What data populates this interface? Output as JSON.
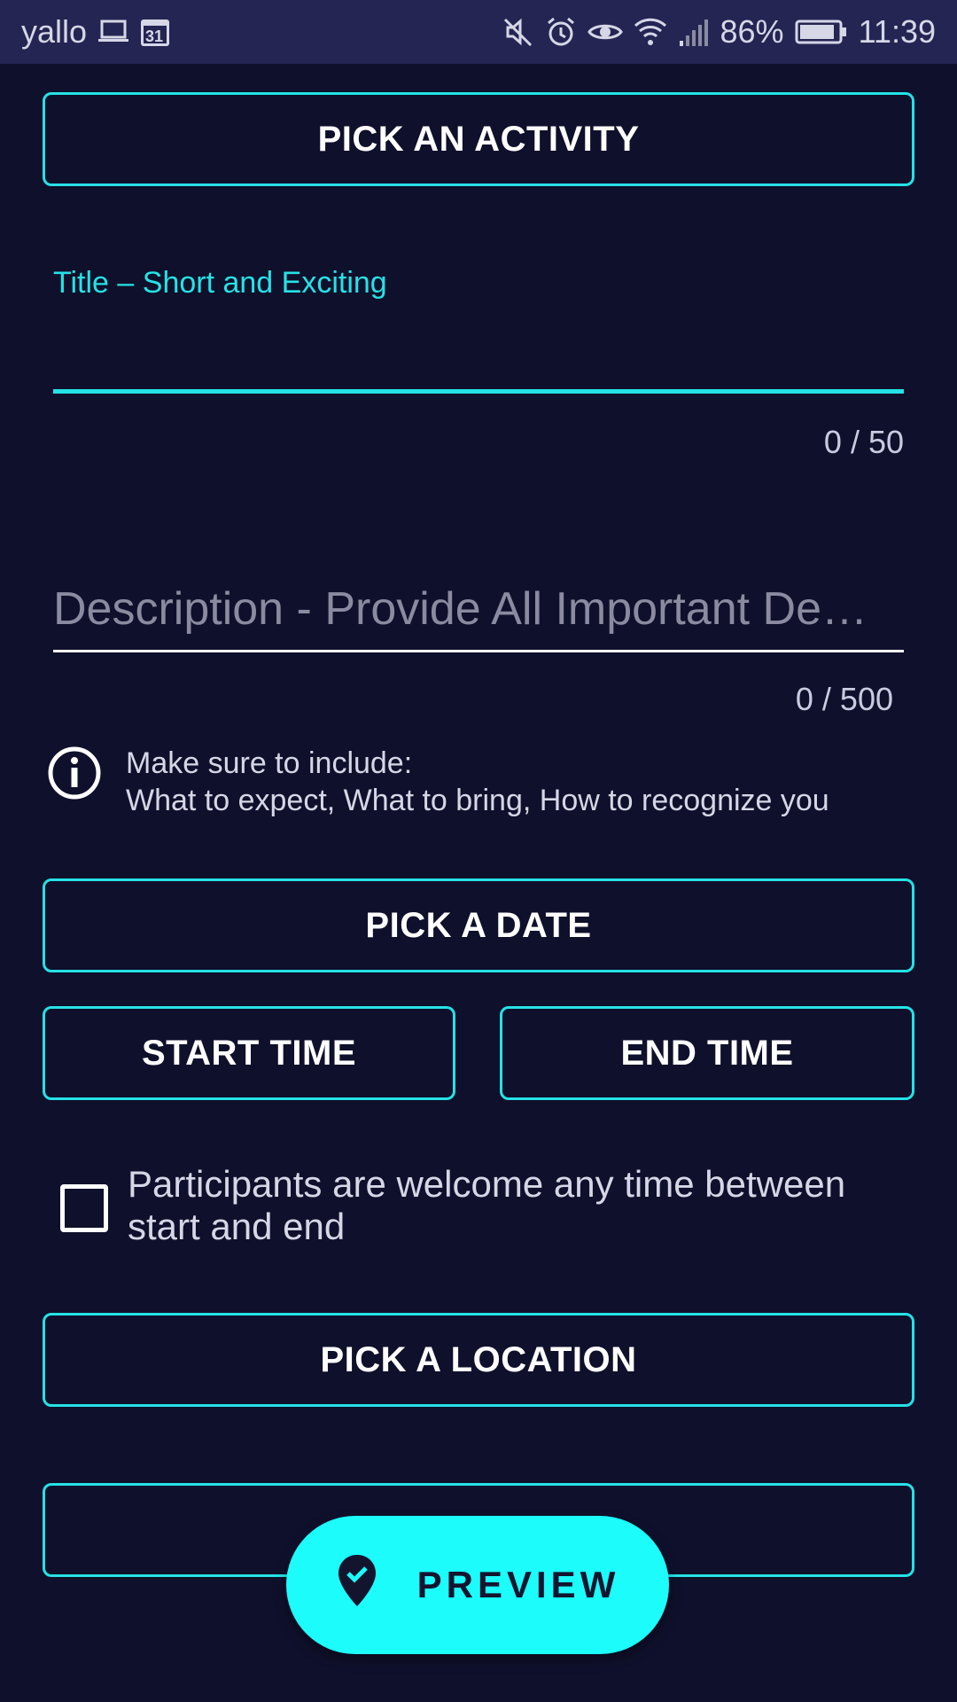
{
  "status_bar": {
    "carrier": "yallo",
    "calendar_day": "31",
    "battery_pct": "86%",
    "time": "11:39"
  },
  "form": {
    "activity_button": "PICK AN ACTIVITY",
    "title_label": "Title – Short and Exciting",
    "title_value": "",
    "title_counter": "0 / 50",
    "description_placeholder": "Description - Provide All Important De…",
    "description_counter": "0 / 500",
    "info_line1": "Make sure to include:",
    "info_line2": "What to expect, What to bring, How to recognize you",
    "date_button": "PICK A DATE",
    "start_time_button": "START TIME",
    "end_time_button": "END TIME",
    "checkbox_checked": false,
    "checkbox_label": "Participants are welcome any time between start and end",
    "location_button": "PICK A LOCATION",
    "extra_button": ""
  },
  "fab": {
    "label": "PREVIEW",
    "icon": "location-check-icon"
  },
  "colors": {
    "accent": "#25e2e6",
    "background": "#0f102b",
    "fab": "#1bfcfb",
    "status_bar": "#242553"
  }
}
